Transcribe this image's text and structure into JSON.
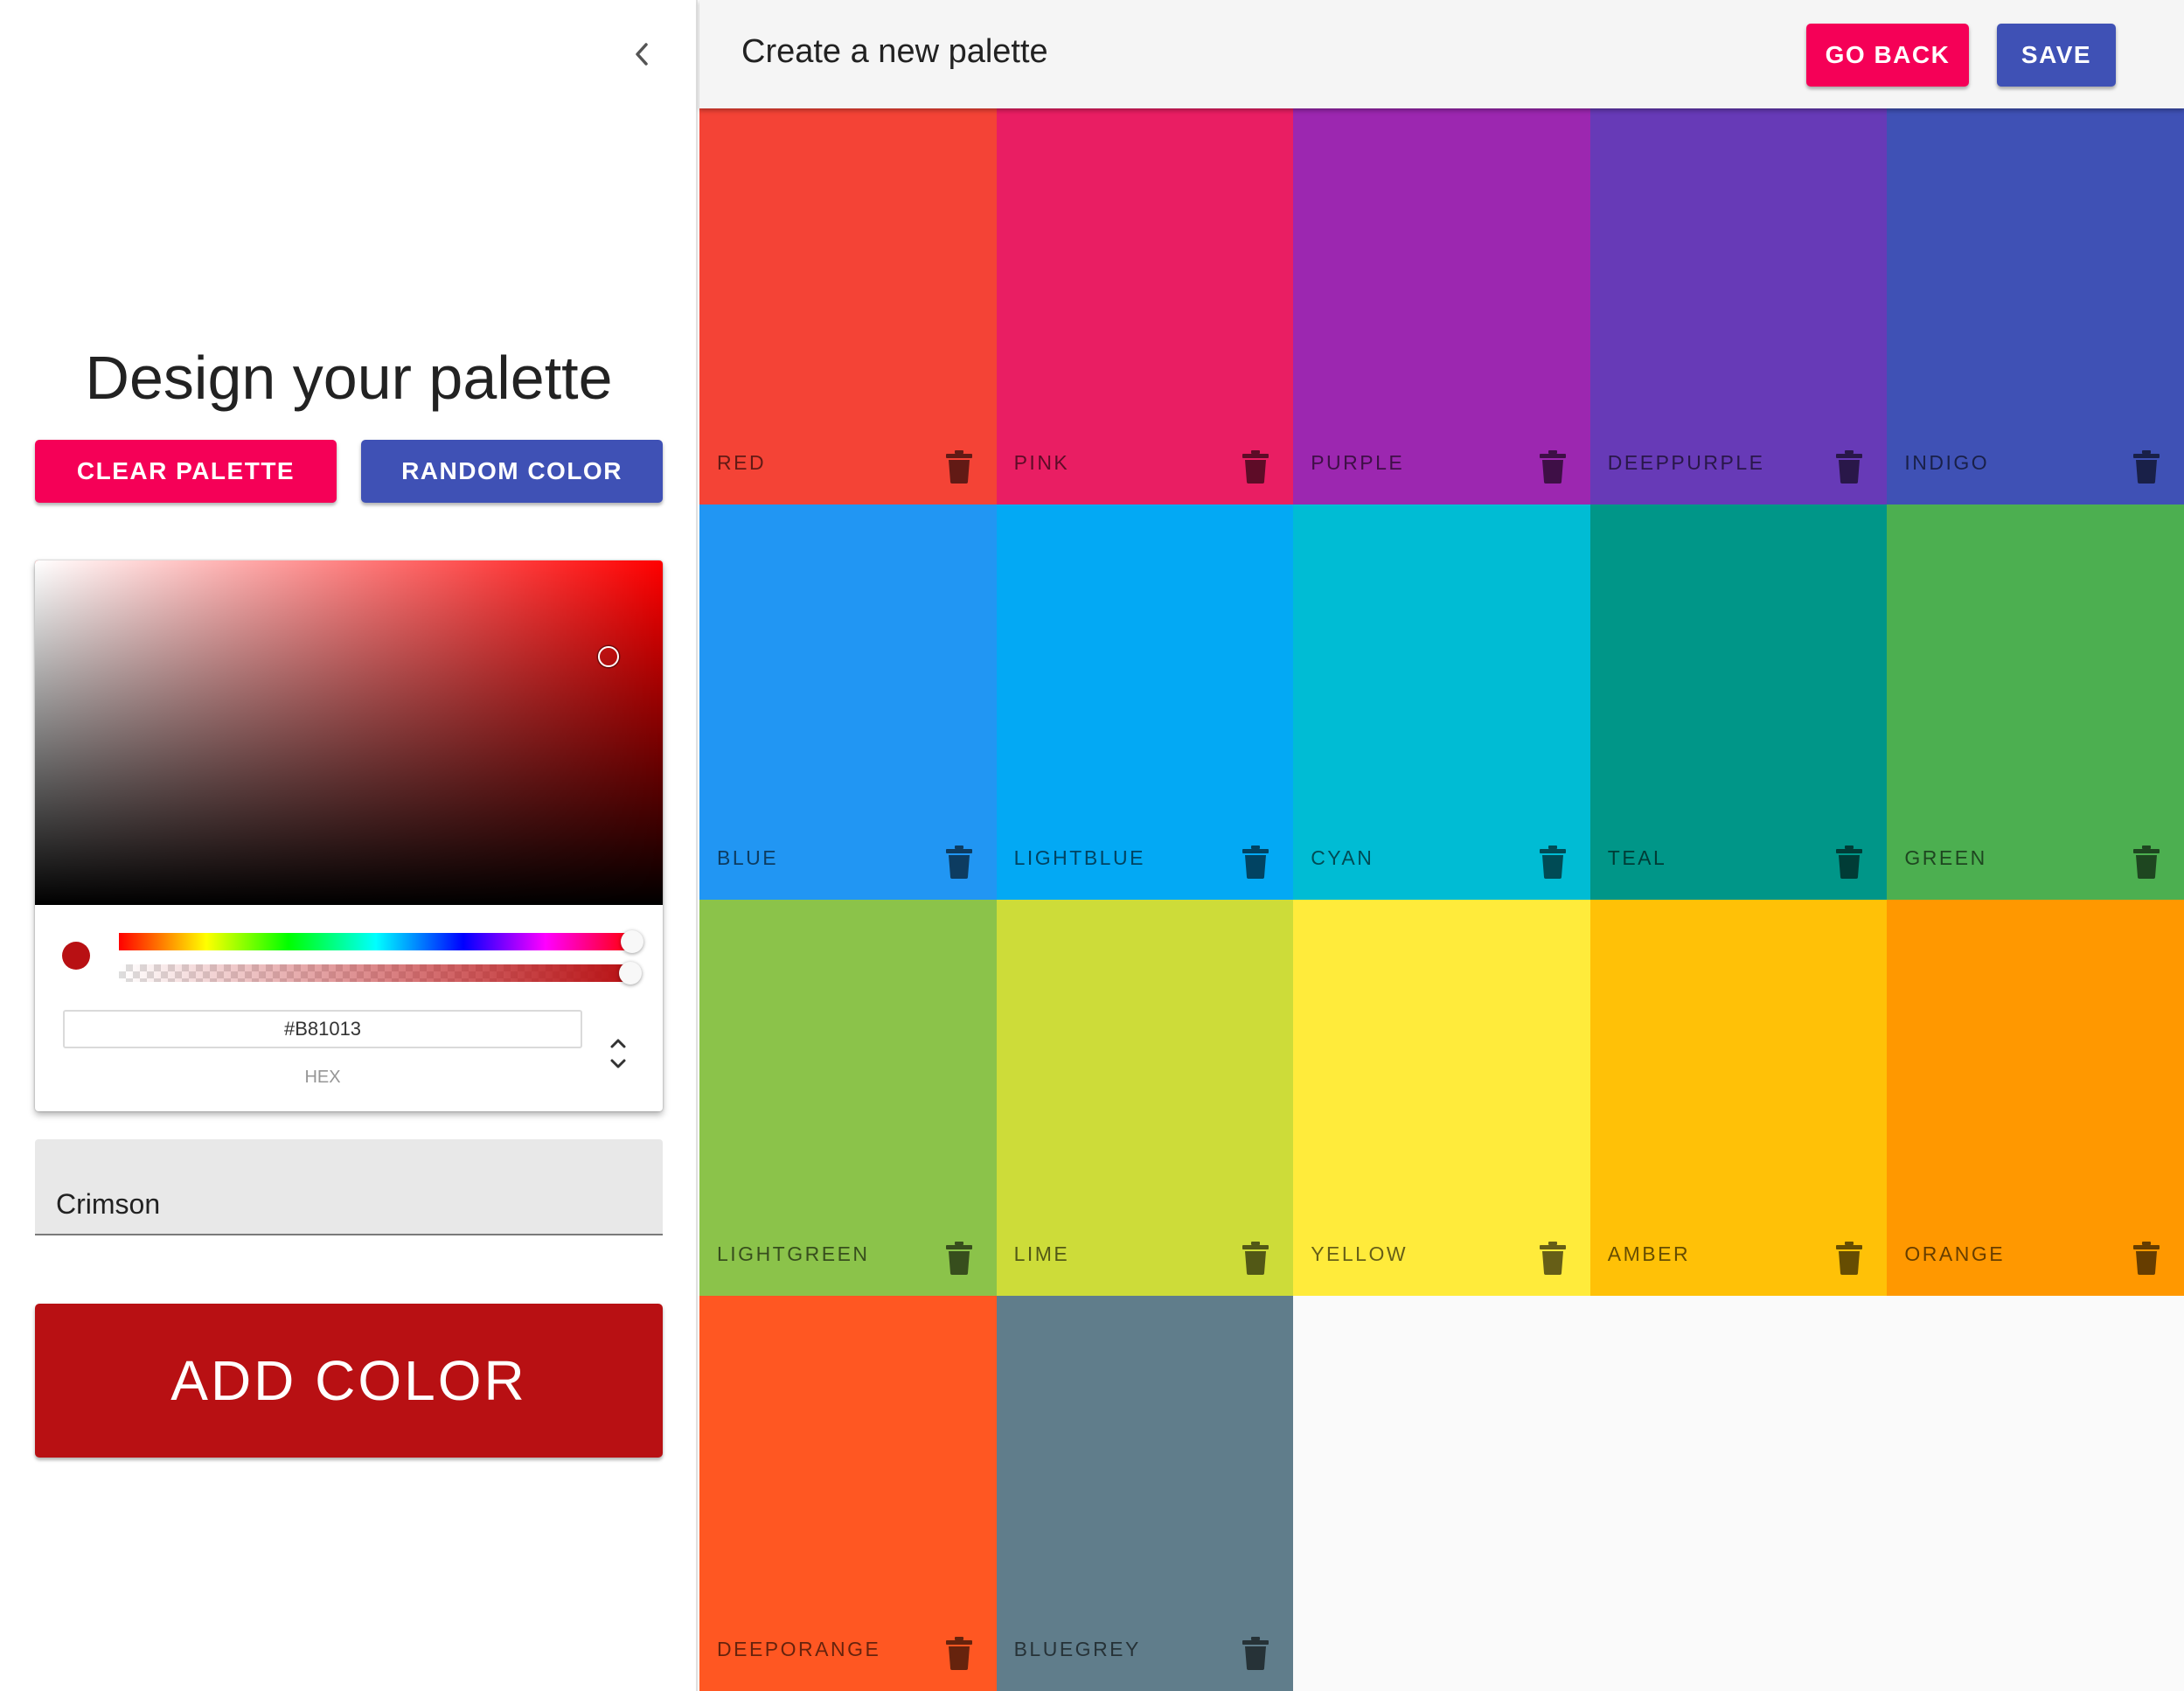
{
  "sidebar": {
    "title": "Design your palette",
    "clear_label": "CLEAR PALETTE",
    "random_label": "RANDOM COLOR",
    "picker": {
      "hex_value": "#B81013",
      "hex_label": "HEX",
      "current_color": "#B81013"
    },
    "name_field": {
      "value": "Crimson"
    },
    "add_label": "ADD COLOR"
  },
  "topbar": {
    "title": "Create a new palette",
    "back_label": "GO BACK",
    "save_label": "SAVE"
  },
  "colors": [
    {
      "name": "RED",
      "hex": "#f44336"
    },
    {
      "name": "PINK",
      "hex": "#e91e63"
    },
    {
      "name": "PURPLE",
      "hex": "#9c27b0"
    },
    {
      "name": "DEEPPURPLE",
      "hex": "#673ab7"
    },
    {
      "name": "INDIGO",
      "hex": "#3f51b5"
    },
    {
      "name": "BLUE",
      "hex": "#2196f3"
    },
    {
      "name": "LIGHTBLUE",
      "hex": "#03a9f4"
    },
    {
      "name": "CYAN",
      "hex": "#00bcd4"
    },
    {
      "name": "TEAL",
      "hex": "#009688"
    },
    {
      "name": "GREEN",
      "hex": "#4caf50"
    },
    {
      "name": "LIGHTGREEN",
      "hex": "#8bc34a"
    },
    {
      "name": "LIME",
      "hex": "#cddc39"
    },
    {
      "name": "YELLOW",
      "hex": "#ffeb3b"
    },
    {
      "name": "AMBER",
      "hex": "#ffc107"
    },
    {
      "name": "ORANGE",
      "hex": "#ff9800"
    },
    {
      "name": "DEEPORANGE",
      "hex": "#ff5722"
    },
    {
      "name": "BLUEGREY",
      "hex": "#607d8b"
    }
  ],
  "icons": {
    "chevron": "chevron-left-icon",
    "trash": "trash-icon",
    "toggle": "up-down-arrows-icon"
  }
}
